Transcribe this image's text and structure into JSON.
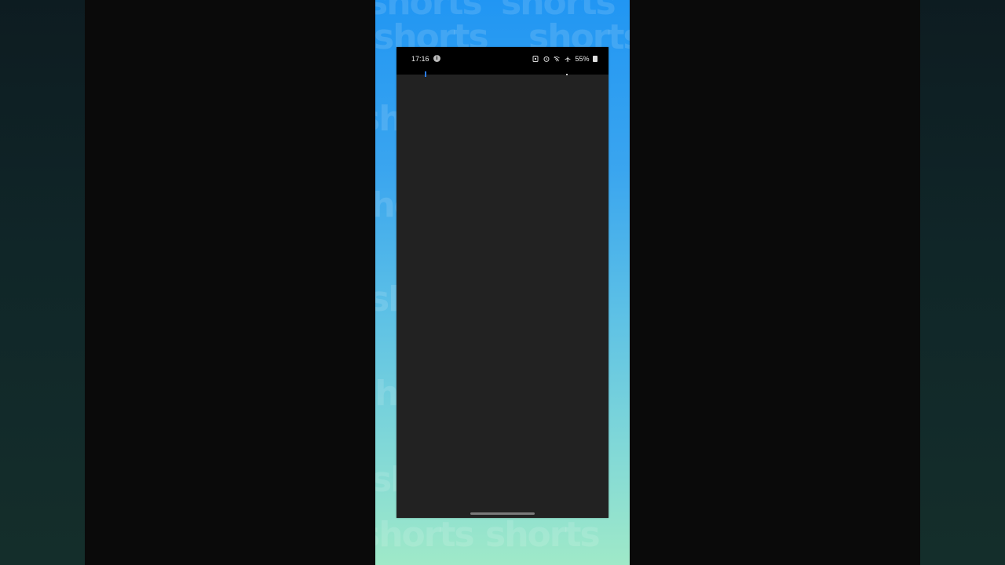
{
  "background": {
    "watermark_word": "shorts",
    "gradient_top": "#2196f3",
    "gradient_bottom": "#9fe9c8"
  },
  "phone": {
    "status_bar": {
      "time": "17:16",
      "battery": "55%",
      "icons": [
        "info-icon",
        "sim-icon",
        "alarm-icon",
        "wifi-off-icon",
        "airplane-mode-icon",
        "battery-icon"
      ]
    },
    "screen_color": "#222222"
  }
}
